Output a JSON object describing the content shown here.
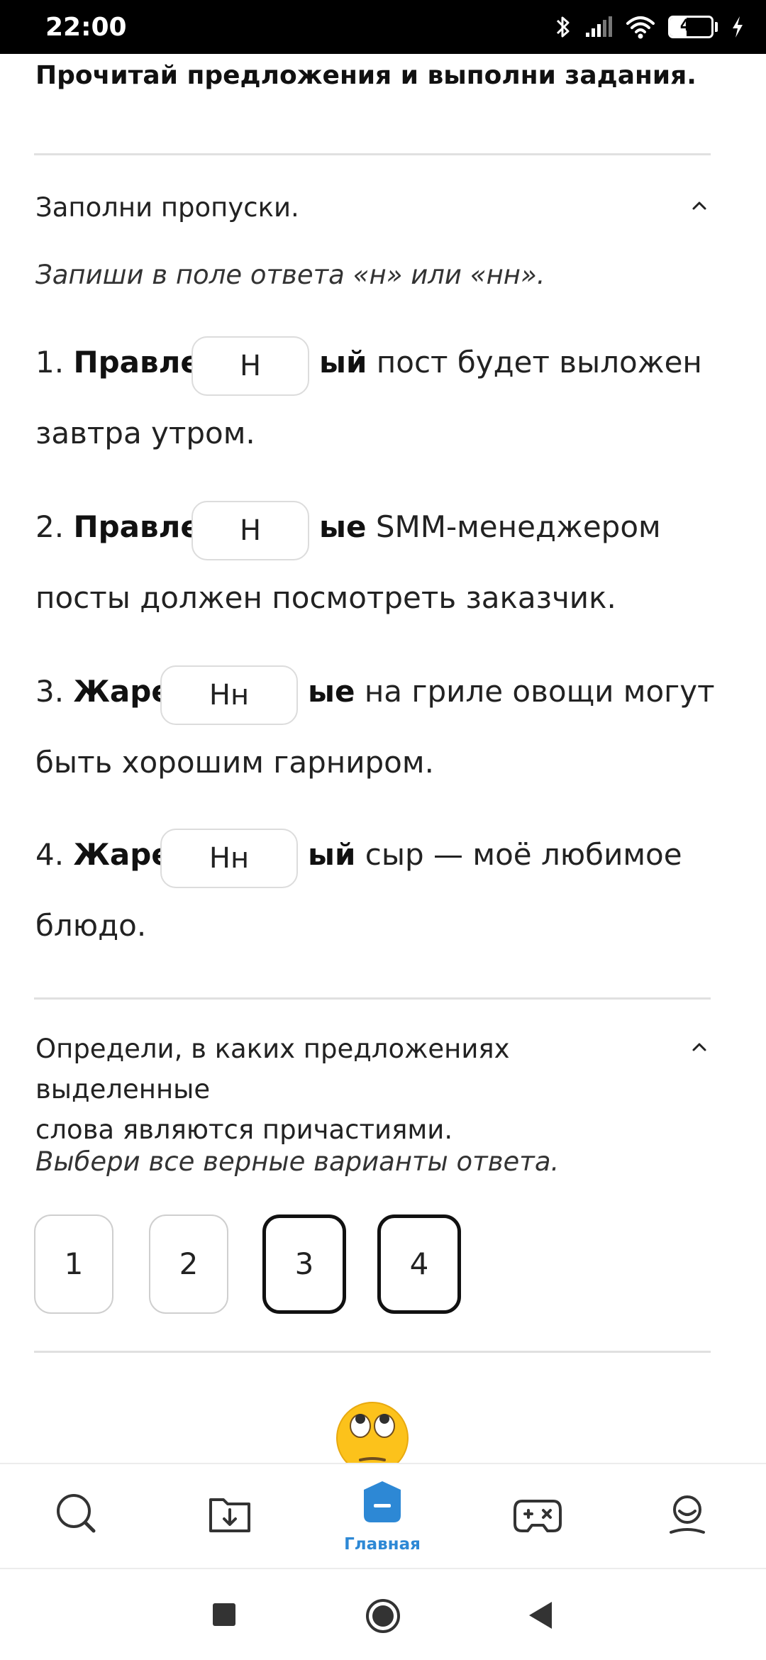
{
  "status_bar": {
    "time": "22:00",
    "battery_level": "40"
  },
  "page": {
    "title": "Прочитай предложения и выполни задания."
  },
  "task1": {
    "heading": "Заполни пропуски.",
    "instruction": "Запиши в поле ответа «н» или «нн».",
    "sentences": [
      {
        "number": "1.",
        "stem": "Правле",
        "answer": "Н",
        "ending": "ый",
        "rest": "пост будет выложен",
        "line2": "завтра утром."
      },
      {
        "number": "2.",
        "stem": "Правле",
        "answer": "Н",
        "ending": "ые",
        "rest": "SMM-менеджером",
        "line2": "посты должен посмотреть заказчик."
      },
      {
        "number": "3.",
        "stem": "Жаре",
        "answer": "Нн",
        "ending": "ые",
        "rest": "на гриле овощи могут",
        "line2": "быть хорошим гарниром."
      },
      {
        "number": "4.",
        "stem": "Жаре",
        "answer": "Нн",
        "ending": "ый",
        "rest": "сыр — моё любимое",
        "line2": "блюдо."
      }
    ]
  },
  "task2": {
    "heading_line1": "Определи, в каких предложениях выделенные",
    "heading_line2": "слова являются причастиями.",
    "instruction": "Выбери все верные варианты ответа.",
    "options": [
      {
        "label": "1",
        "selected": false
      },
      {
        "label": "2",
        "selected": false
      },
      {
        "label": "3",
        "selected": true
      },
      {
        "label": "4",
        "selected": true
      }
    ]
  },
  "bottom_nav": {
    "items": [
      {
        "icon": "search-icon"
      },
      {
        "icon": "download-folder-icon"
      },
      {
        "icon": "home-icon",
        "label": "Главная",
        "active": true
      },
      {
        "icon": "gamepad-icon"
      },
      {
        "icon": "profile-icon"
      }
    ],
    "active_color": "#2d88d5"
  },
  "system_nav": {
    "icons": [
      "recent-apps-icon",
      "home-button-icon",
      "back-icon"
    ]
  }
}
